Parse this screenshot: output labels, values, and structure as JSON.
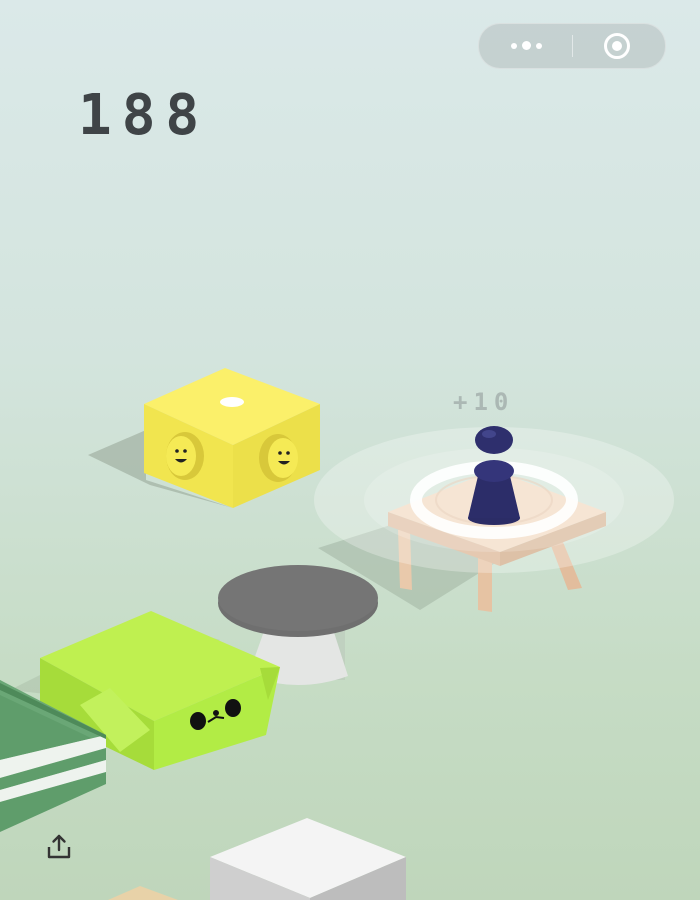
{
  "hud": {
    "score": "188",
    "bonus_popup": "+10"
  },
  "top_capsule": {
    "more_icon": "more-dots-icon",
    "close_icon": "target-circle-icon"
  },
  "bottom_bar": {
    "share_icon": "share-upload-icon"
  },
  "colors": {
    "background_top": "#dbe9e9",
    "background_bottom": "#bfd6bb",
    "score_text": "#3f4447",
    "yellow_block": "#f4ea56",
    "lime_block": "#b4ee47",
    "green_block": "#5f9d6b",
    "wood_stool": "#e8c6a8",
    "player_piece": "#2b2c66",
    "gray_table": "#6f6f6f",
    "white_block": "#f0f0f0"
  }
}
